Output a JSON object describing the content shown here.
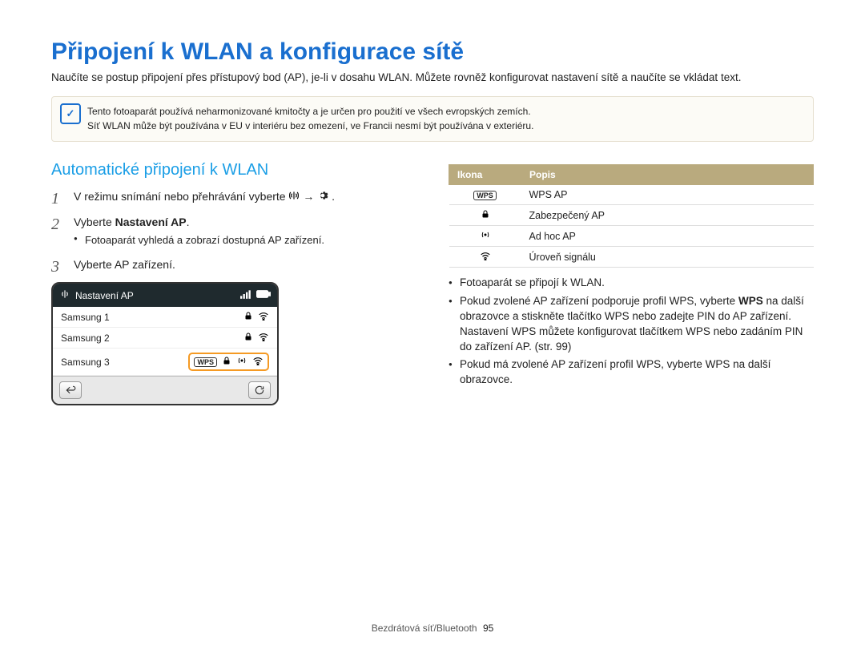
{
  "title": "Připojení k WLAN a konfigurace sítě",
  "intro": "Naučíte se postup připojení přes přístupový bod (AP), je-li v dosahu WLAN. Můžete rovněž konfigurovat nastavení sítě a naučíte se vkládat text.",
  "note_icon": "✓",
  "subhead": "Automatické připojení k WLAN",
  "note": {
    "line1": "Tento fotoaparát používá neharmonizované kmitočty a je určen pro použití ve všech evropských zemích.",
    "line2": "Síť WLAN může být používána v EU v interiéru bez omezení, ve Francii nesmí být používána v exteriéru."
  },
  "steps": {
    "s1_pre": "V režimu snímání nebo přehrávání vyberte ",
    "s1_post": ".",
    "s2_pre": "Vyberte ",
    "s2_bold": "Nastavení AP",
    "s2_post": ".",
    "s2_sub1": "Fotoaparát vyhledá a zobrazí dostupná AP zařízení.",
    "s3": "Vyberte AP zařízení."
  },
  "device": {
    "title": "Nastavení AP",
    "rows": [
      {
        "name": "Samsung 1",
        "wps": false,
        "lock": true,
        "adhoc": false,
        "wifi": true,
        "selected": false
      },
      {
        "name": "Samsung 2",
        "wps": false,
        "lock": true,
        "adhoc": false,
        "wifi": true,
        "selected": false
      },
      {
        "name": "Samsung 3",
        "wps": true,
        "lock": true,
        "adhoc": true,
        "wifi": true,
        "selected": true
      }
    ],
    "wps_label": "WPS"
  },
  "icon_table": {
    "head_icon": "Ikona",
    "head_desc": "Popis",
    "rows": [
      {
        "icon_type": "wps",
        "label": "WPS",
        "desc": "WPS AP"
      },
      {
        "icon_type": "lock",
        "label": "lock",
        "desc": "Zabezpečený AP"
      },
      {
        "icon_type": "adhoc",
        "label": "adhoc",
        "desc": "Ad hoc AP"
      },
      {
        "icon_type": "wifi",
        "label": "wifi",
        "desc": "Úroveň signálu"
      }
    ]
  },
  "right_bullets": {
    "b1": "Fotoaparát se připojí k WLAN.",
    "b2_pre": "Pokud zvolené AP zařízení podporuje profil WPS, vyberte ",
    "b2_bold": "WPS",
    "b2_post": " na další obrazovce a stiskněte tlačítko WPS nebo zadejte PIN do AP zařízení. Nastavení WPS můžete konfigurovat tlačítkem WPS nebo zadáním PIN do zařízení AP. (str. 99)",
    "b3": "Pokud má zvolené AP zařízení profil WPS, vyberte WPS na další obrazovce."
  },
  "footer": {
    "section": "Bezdrátová síť/Bluetooth",
    "page": "95"
  }
}
